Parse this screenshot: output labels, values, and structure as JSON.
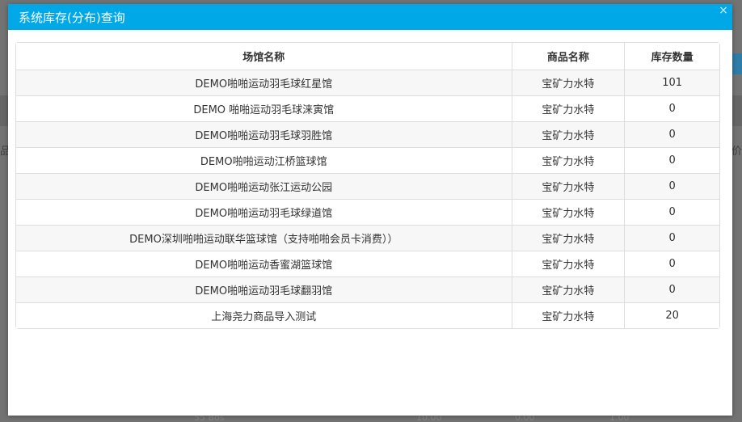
{
  "dialog": {
    "title": "系统库存(分布)查询",
    "close_glyph": "×"
  },
  "table": {
    "headers": [
      "场馆名称",
      "商品名称",
      "库存数量"
    ],
    "rows": [
      [
        "DEMO啪啪运动羽毛球红星馆",
        "宝矿力水特",
        "101"
      ],
      [
        "DEMO 啪啪运动羽毛球涞寅馆",
        "宝矿力水特",
        "0"
      ],
      [
        "DEMO啪啪运动羽毛球羽胜馆",
        "宝矿力水特",
        "0"
      ],
      [
        "DEMO啪啪运动江桥篮球馆",
        "宝矿力水特",
        "0"
      ],
      [
        "DEMO啪啪运动张江运动公园",
        "宝矿力水特",
        "0"
      ],
      [
        "DEMO啪啪运动羽毛球绿道馆",
        "宝矿力水特",
        "0"
      ],
      [
        "DEMO深圳啪啪运动联华篮球馆（支持啪啪会员卡消费））",
        "宝矿力水特",
        "0"
      ],
      [
        "DEMO啪啪运动香蜜湖篮球馆",
        "宝矿力水特",
        "0"
      ],
      [
        "DEMO啪啪运动羽毛球翻羽馆",
        "宝矿力水特",
        "0"
      ],
      [
        "上海尧力商品导入测试",
        "宝矿力水特",
        "20"
      ]
    ]
  },
  "background": {
    "left_frag_1": "品",
    "right_frag_1": "价",
    "bottom_frag_1": "55 Bos",
    "bottom_frag_2": "10.00",
    "bottom_frag_3": "0.00",
    "bottom_frag_4": "1.00"
  },
  "colors": {
    "header_bg": "#00a8e8",
    "header_text": "#ffffff",
    "overlay": "#737373"
  }
}
